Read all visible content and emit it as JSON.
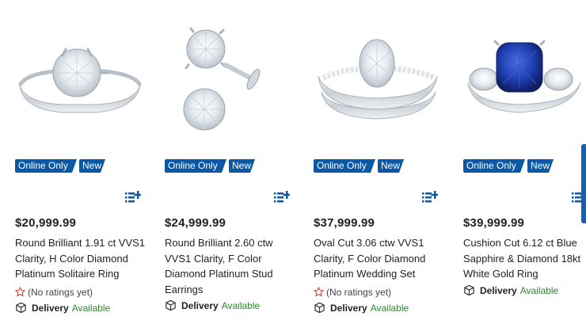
{
  "colors": {
    "badge": "#0b58a6",
    "available": "#2a8a2a",
    "sapphire": "#1f3fb0"
  },
  "icons": {
    "add_to_list": "list-plus-icon",
    "rating": "star-outline-icon",
    "delivery": "box-icon"
  },
  "products": [
    {
      "badges": [
        "Online Only",
        "New"
      ],
      "price": "$20,999.99",
      "title": "Round Brilliant 1.91 ct VVS1 Clarity, H Color Diamond Platinum Solitaire Ring",
      "ratings": "(No ratings yet)",
      "delivery_label": "Delivery",
      "delivery_status": "Available"
    },
    {
      "badges": [
        "Online Only",
        "New"
      ],
      "price": "$24,999.99",
      "title": "Round Brilliant 2.60 ctw VVS1 Clarity, F Color Diamond Platinum Stud Earrings",
      "ratings": null,
      "delivery_label": "Delivery",
      "delivery_status": "Available"
    },
    {
      "badges": [
        "Online Only",
        "New"
      ],
      "price": "$37,999.99",
      "title": "Oval Cut 3.06 ctw VVS1 Clarity, F Color Diamond Platinum Wedding Set",
      "ratings": "(No ratings yet)",
      "delivery_label": "Delivery",
      "delivery_status": "Available"
    },
    {
      "badges": [
        "Online Only",
        "New"
      ],
      "price": "$39,999.99",
      "title": "Cushion Cut 6.12 ct Blue Sapphire & Diamond 18kt White Gold Ring",
      "ratings": null,
      "delivery_label": "Delivery",
      "delivery_status": "Available"
    }
  ]
}
